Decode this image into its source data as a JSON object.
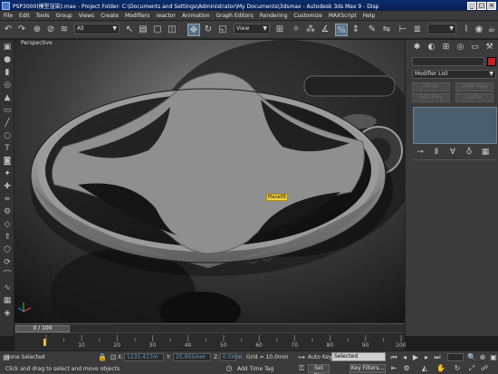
{
  "window": {
    "title": "PSP3000(模型渲染).max - Project Folder: C:\\Documents and Settings\\Administrator\\My Documents\\3dsmax - Autodesk 3ds Max 9 - Disp"
  },
  "menu": [
    "File",
    "Edit",
    "Tools",
    "Group",
    "Views",
    "Create",
    "Modifiers",
    "reactor",
    "Animation",
    "Graph Editors",
    "Rendering",
    "Customize",
    "MAXScript",
    "Help"
  ],
  "toolbar": {
    "selection_filter": "All",
    "reference_coord": "View"
  },
  "viewport": {
    "label": "Perspective",
    "object_label": "Plane05"
  },
  "command_panel": {
    "modifier_list": "Modifier List",
    "buttons": [
      "Mirror",
      "UVW Map",
      "Edit Poly",
      "Lathe"
    ],
    "accent_color": "#c81e1e"
  },
  "timeline": {
    "frame_display": "0 / 100",
    "tick_labels": [
      "10",
      "20",
      "30",
      "40",
      "50",
      "60",
      "70",
      "80",
      "90",
      "100"
    ]
  },
  "status": {
    "selection": "None Selected",
    "prompt": "Click and drag to select and move objects",
    "x_label": "X:",
    "x_value": "1231.417m",
    "y_label": "Y:",
    "y_value": "25.955mm",
    "z_label": "Z:",
    "z_value": "0.0mm",
    "grid": "Grid = 10.0mm",
    "add_time_tag": "Add Time Tag",
    "auto_key": "Auto Key",
    "set_key": "Set Key",
    "key_mode": "Selected",
    "key_filters": "Key Filters..."
  }
}
